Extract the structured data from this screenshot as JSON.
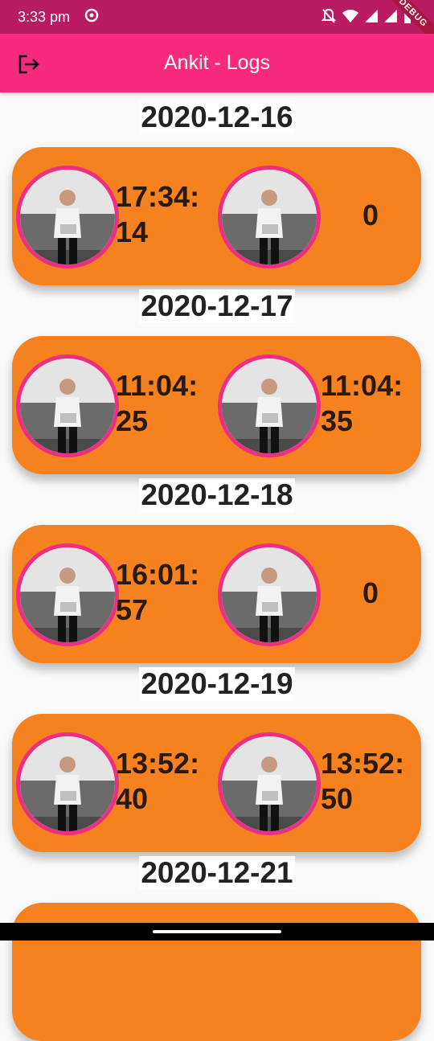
{
  "status_bar": {
    "time": "3:33 pm",
    "debug_label": "DEBUG",
    "background_color": "#b91c62"
  },
  "app_bar": {
    "title": "Ankit - Logs",
    "logout_icon": "logout-icon",
    "background_color": "#f72a7d"
  },
  "logs": [
    {
      "date": "2020-12-16",
      "in_time_line1": "17:34:",
      "in_time_line2": "14",
      "out_time_line1": "0",
      "out_time_line2": ""
    },
    {
      "date": "2020-12-17",
      "in_time_line1": "11:04:",
      "in_time_line2": "25",
      "out_time_line1": "11:04:",
      "out_time_line2": "35"
    },
    {
      "date": "2020-12-18",
      "in_time_line1": "16:01:",
      "in_time_line2": "57",
      "out_time_line1": "0",
      "out_time_line2": ""
    },
    {
      "date": "2020-12-19",
      "in_time_line1": "13:52:",
      "in_time_line2": "40",
      "out_time_line1": "13:52:",
      "out_time_line2": "50"
    },
    {
      "date": "2020-12-21"
    }
  ],
  "colors": {
    "card": "#f5821f",
    "avatar_border": "#ec2f82"
  }
}
